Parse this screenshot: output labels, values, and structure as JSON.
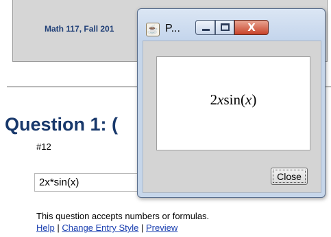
{
  "page": {
    "course_title": "Math 117, Fall 201",
    "question_heading": "Question 1: (",
    "question_number": "#12",
    "answer_value": "2x*sin(x)",
    "help_text": "This question accepts numbers or formulas.",
    "links": {
      "help": "Help",
      "separator1": " | ",
      "change_entry_style": "Change Entry Style",
      "separator2": " | ",
      "preview": "Preview"
    }
  },
  "popup": {
    "title": "P...",
    "app_icon": "java-icon",
    "buttons": {
      "minimize_icon": "minimize-icon",
      "maximize_icon": "maximize-icon",
      "close_icon": "close-icon",
      "close_glyph": "X"
    },
    "formula": "2xsin(x)",
    "close_label": "Close"
  },
  "colors": {
    "heading": "#18386b",
    "link": "#1a3fb0",
    "titlebar": "#c4d5ec",
    "close_button": "#c8432a"
  }
}
